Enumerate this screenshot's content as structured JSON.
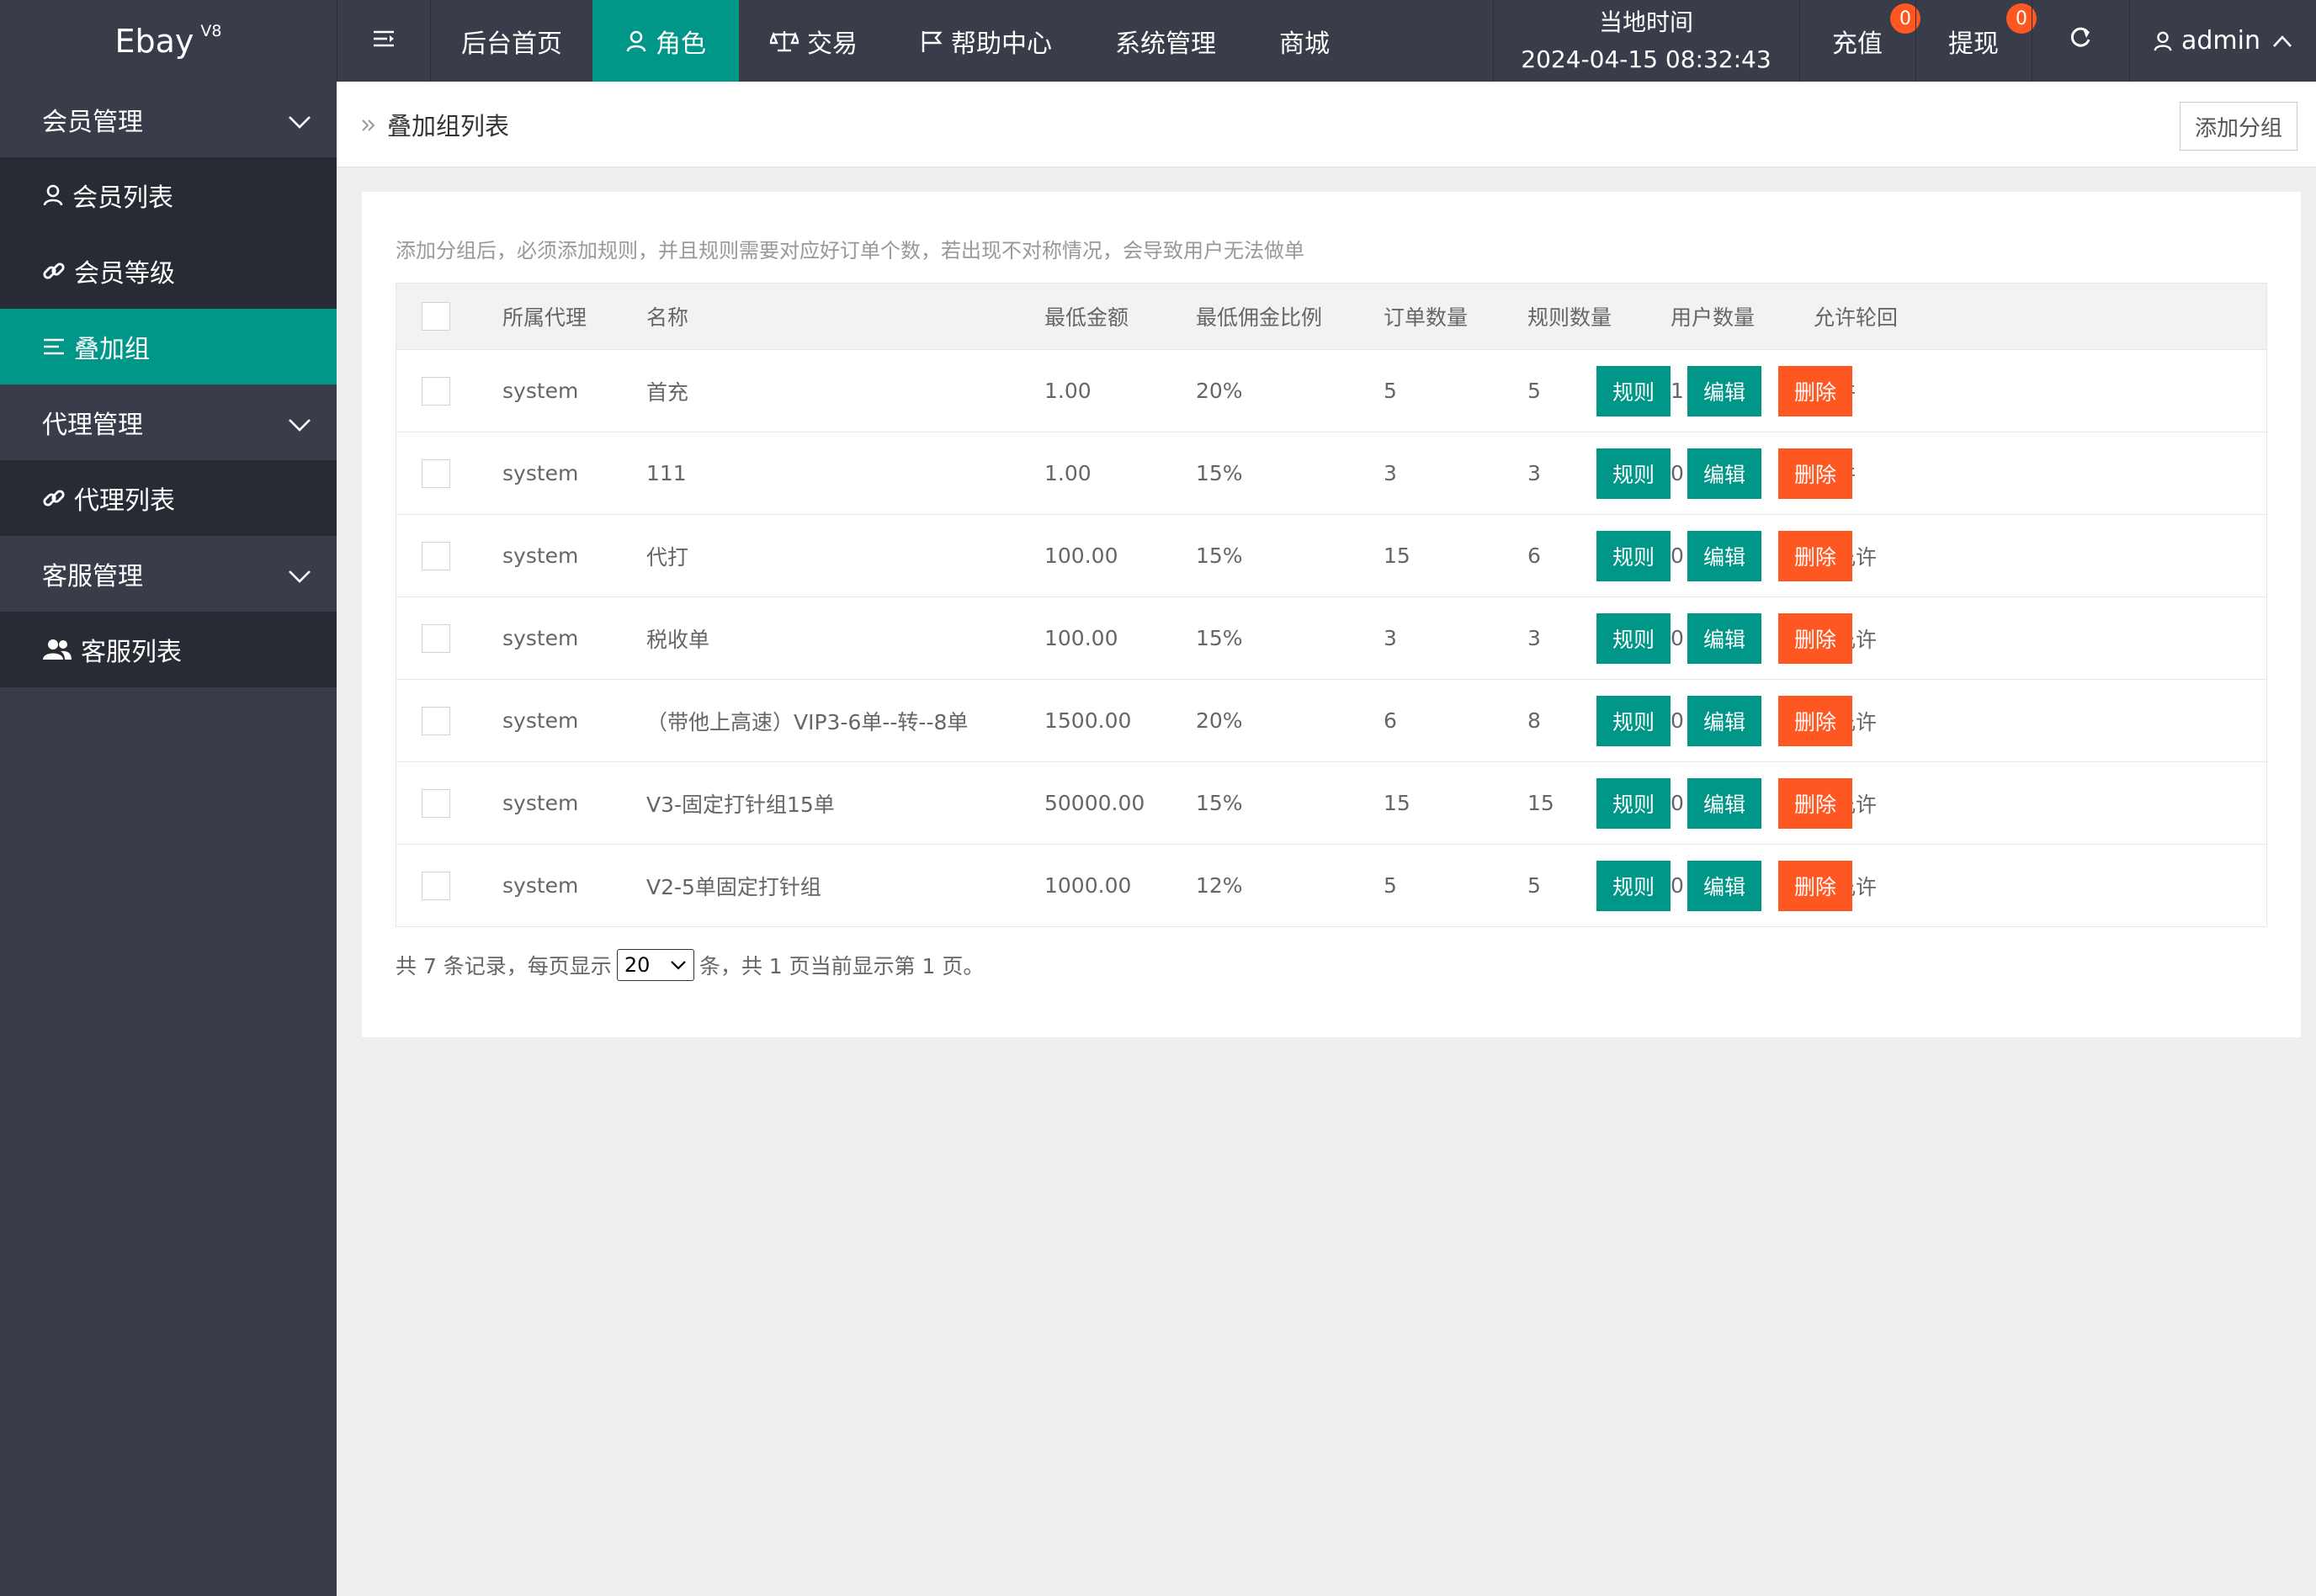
{
  "app": {
    "name": "Ebay",
    "version": "V8"
  },
  "topnav": {
    "menu_toggle": "menu-toggle",
    "items": [
      "后台首页",
      "角色",
      "交易",
      "帮助中心",
      "系统管理",
      "商城"
    ],
    "time_label": "当地时间",
    "time_value": "2024-04-15 08:32:43",
    "recharge": "充值",
    "recharge_badge": "0",
    "withdraw": "提现",
    "withdraw_badge": "0",
    "user": "admin"
  },
  "sidebar": {
    "items": [
      "会员管理",
      "会员列表",
      "会员等级",
      "叠加组",
      "代理管理",
      "代理列表",
      "客服管理",
      "客服列表"
    ]
  },
  "breadcrumb": {
    "title": "叠加组列表",
    "add_button": "添加分组"
  },
  "tip": "添加分组后，必须添加规则，并且规则需要对应好订单个数，若出现不对称情况，会导致用户无法做单",
  "table": {
    "headers": [
      "所属代理",
      "名称",
      "最低金额",
      "最低佣金比例",
      "订单数量",
      "规则数量",
      "用户数量",
      "允许轮回"
    ],
    "actions": [
      "规则",
      "编辑",
      "删除"
    ],
    "rows": [
      {
        "agent": "system",
        "name": "首充",
        "min_amount": "1.00",
        "min_rate": "20%",
        "orders": "5",
        "rules": "5",
        "users": "1",
        "loop": "允许"
      },
      {
        "agent": "system",
        "name": "111",
        "min_amount": "1.00",
        "min_rate": "15%",
        "orders": "3",
        "rules": "3",
        "users": "0",
        "loop": "允许"
      },
      {
        "agent": "system",
        "name": "代打",
        "min_amount": "100.00",
        "min_rate": "15%",
        "orders": "15",
        "rules": "6",
        "users": "0",
        "loop": "不允许"
      },
      {
        "agent": "system",
        "name": "税收单",
        "min_amount": "100.00",
        "min_rate": "15%",
        "orders": "3",
        "rules": "3",
        "users": "0",
        "loop": "不允许"
      },
      {
        "agent": "system",
        "name": "（带他上高速）VIP3-6单--转--8单",
        "min_amount": "1500.00",
        "min_rate": "20%",
        "orders": "6",
        "rules": "8",
        "users": "0",
        "loop": "不允许"
      },
      {
        "agent": "system",
        "name": "V3-固定打针组15单",
        "min_amount": "50000.00",
        "min_rate": "15%",
        "orders": "15",
        "rules": "15",
        "users": "0",
        "loop": "不允许"
      },
      {
        "agent": "system",
        "name": "V2-5单固定打针组",
        "min_amount": "1000.00",
        "min_rate": "12%",
        "orders": "5",
        "rules": "5",
        "users": "0",
        "loop": "不允许"
      }
    ]
  },
  "pager": {
    "prefix": "共 7 条记录，每页显示",
    "page_size": "20",
    "suffix": "条，共 1 页当前显示第 1 页。"
  },
  "colors": {
    "accent": "#009688",
    "danger": "#ff5722",
    "dark": "#393d49"
  }
}
